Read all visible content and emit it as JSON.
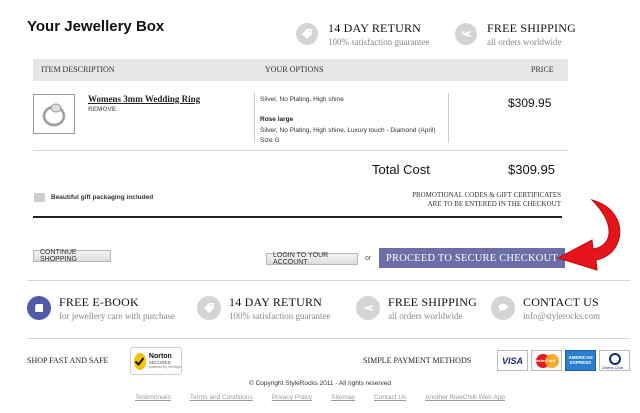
{
  "header": {
    "title": "Your Jewellery Box",
    "feature1": {
      "title": "14 DAY RETURN",
      "sub": "100% satisfaction guarantee",
      "icon": "tag-icon"
    },
    "feature2": {
      "title": "FREE SHIPPING",
      "sub": "all orders worldwide",
      "icon": "airplane-icon"
    }
  },
  "table": {
    "headers": {
      "description": "ITEM DESCRIPTION",
      "options": "YOUR OPTIONS",
      "price": "PRICE"
    },
    "item": {
      "name": "Womens 3mm Wedding Ring",
      "remove": "REMOVE",
      "option1": "Silver, No Plating, High shine",
      "option2_title": "Rose large",
      "option2": "Silver, No Plating, High shine, Luxury touch - Diamond (April)",
      "option3": "Size G",
      "price": "$309.95"
    }
  },
  "total": {
    "label": "Total Cost",
    "value": "$309.95"
  },
  "gift": {
    "label": "Beautiful gift packaging included"
  },
  "promo": {
    "line1": "PROMOTIONAL CODES & GIFT CERTIFICATES",
    "line2": "ARE TO BE ENTERED IN THE CHECKOUT"
  },
  "actions": {
    "continue": "CONTINUE SHOPPING",
    "login": "LOGIN TO YOUR ACCOUNT",
    "or": "or",
    "checkout": "PROCEED TO SECURE CHECKOUT"
  },
  "features": [
    {
      "title": "FREE E-BOOK",
      "sub": "for jewellery care with purchase",
      "icon": "book-icon"
    },
    {
      "title": "14 DAY RETURN",
      "sub": "100% satisfaction guarantee",
      "icon": "tag-icon"
    },
    {
      "title": "FREE SHIPPING",
      "sub": "all orders worldwide",
      "icon": "airplane-icon"
    },
    {
      "title": "CONTACT US",
      "sub": "info@stylerocks.com",
      "icon": "chat-icon"
    }
  ],
  "trust": {
    "shop_label": "SHOP FAST AND SAFE",
    "norton": {
      "top": "Norton",
      "bottom": "SECURED",
      "powered": "powered by VeriSign"
    },
    "payment_label": "SIMPLE PAYMENT METHODS",
    "cards": [
      "VISA",
      "MasterCard",
      "AMERICAN EXPRESS",
      "Diners Club"
    ]
  },
  "footer": {
    "copyright": "© Copyright StyleRocks 2011 - All rights reserved",
    "links": [
      "Testimonials",
      "Terms and Conditions",
      "Privacy Policy",
      "Sitemap",
      "Contact Us",
      "Another BlueChilli Web App"
    ]
  },
  "colors": {
    "checkout": "#6a6fa8",
    "arrow": "#e8141b",
    "ebook": "#4f5aa8"
  }
}
